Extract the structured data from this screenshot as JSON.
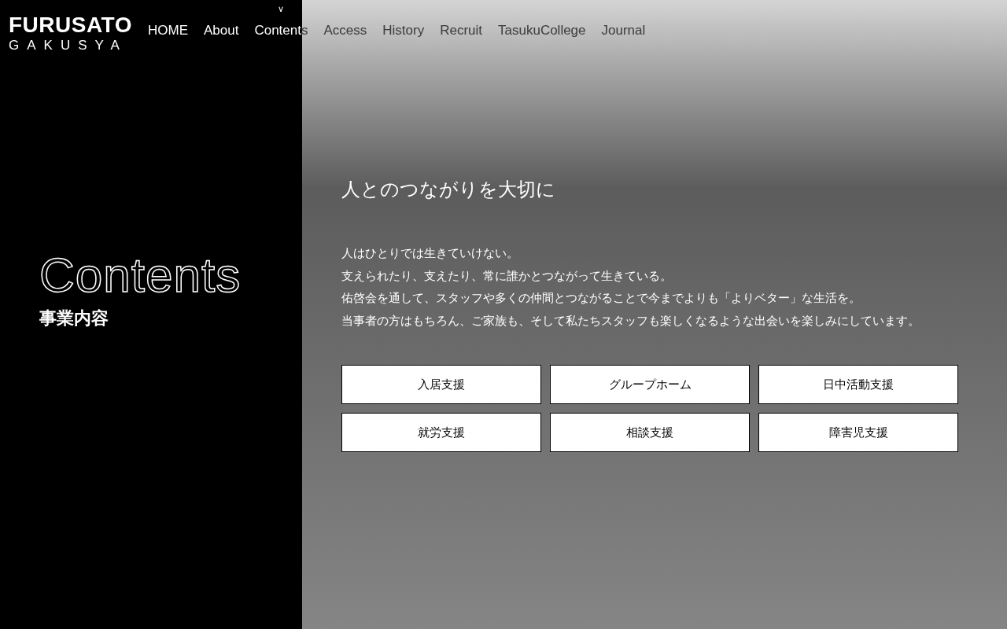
{
  "logo": {
    "line1": "FURUSATO",
    "line2": "GAKUSYA"
  },
  "nav": {
    "marker": "∨",
    "items": [
      {
        "label": "HOME",
        "selected": false
      },
      {
        "label": "About",
        "selected": false
      },
      {
        "label": "Contents",
        "selected": true
      },
      {
        "label": "Access",
        "selected": false
      },
      {
        "label": "History",
        "selected": false
      },
      {
        "label": "Recruit",
        "selected": false
      },
      {
        "label": "TasukuCollege",
        "selected": false
      },
      {
        "label": "Journal",
        "selected": false
      }
    ]
  },
  "section": {
    "title": "Contents",
    "subtitle": "事業内容"
  },
  "hero": {
    "heading": "人とのつながりを大切に",
    "lines": [
      "人はひとりでは生きていけない。",
      "支えられたり、支えたり、常に誰かとつながって生きている。",
      "佑啓会を通して、スタッフや多くの仲間とつながることで今までよりも「よりベター」な生活を。",
      "当事者の方はもちろん、ご家族も、そして私たちスタッフも楽しくなるような出会いを楽しみにしています。"
    ]
  },
  "buttons": [
    "入居支援",
    "グループホーム",
    "日中活動支援",
    "就労支援",
    "相談支援",
    "障害児支援"
  ]
}
